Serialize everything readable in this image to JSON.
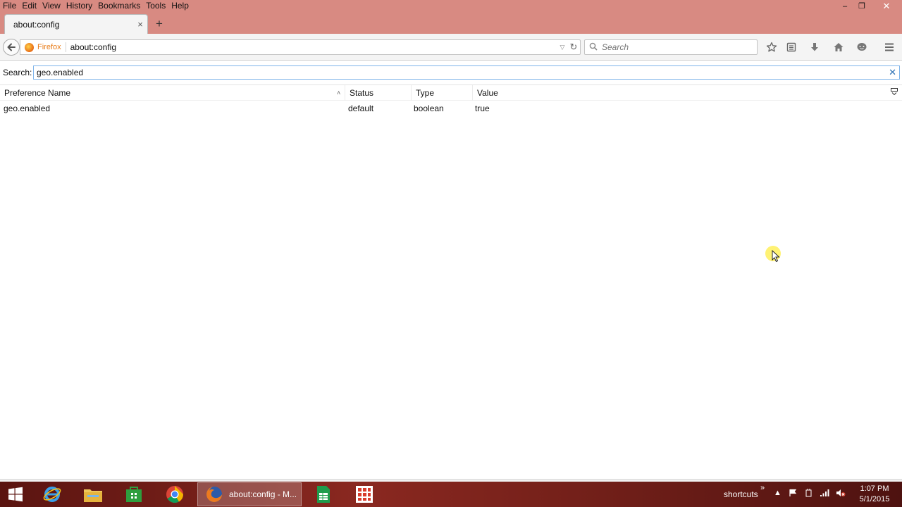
{
  "menubar": {
    "items": [
      "File",
      "Edit",
      "View",
      "History",
      "Bookmarks",
      "Tools",
      "Help"
    ]
  },
  "window_controls": {
    "minimize_icon": "minimize-icon",
    "restore_icon": "restore-icon",
    "close_icon": "close-icon"
  },
  "tab": {
    "title": "about:config",
    "close_glyph": "×",
    "new_tab_glyph": "+"
  },
  "navbar": {
    "identity_label": "Firefox",
    "url": "about:config",
    "search_placeholder": "Search"
  },
  "config": {
    "search_label": "Search:",
    "search_value": "geo.enabled",
    "clear_glyph": "✕",
    "columns": {
      "name": "Preference Name",
      "status": "Status",
      "type": "Type",
      "value": "Value"
    },
    "rows": [
      {
        "name": "geo.enabled",
        "status": "default",
        "type": "boolean",
        "value": "true"
      }
    ]
  },
  "taskbar": {
    "active_window_label": "about:config - M...",
    "tray_label": "shortcuts",
    "clock_time": "1:07 PM",
    "clock_date": "5/1/2015"
  },
  "colors": {
    "titlebar": "#d88a82",
    "taskbar": "#8a2820",
    "filter_border": "#7eb4ea",
    "identity": "#e87d1a"
  }
}
